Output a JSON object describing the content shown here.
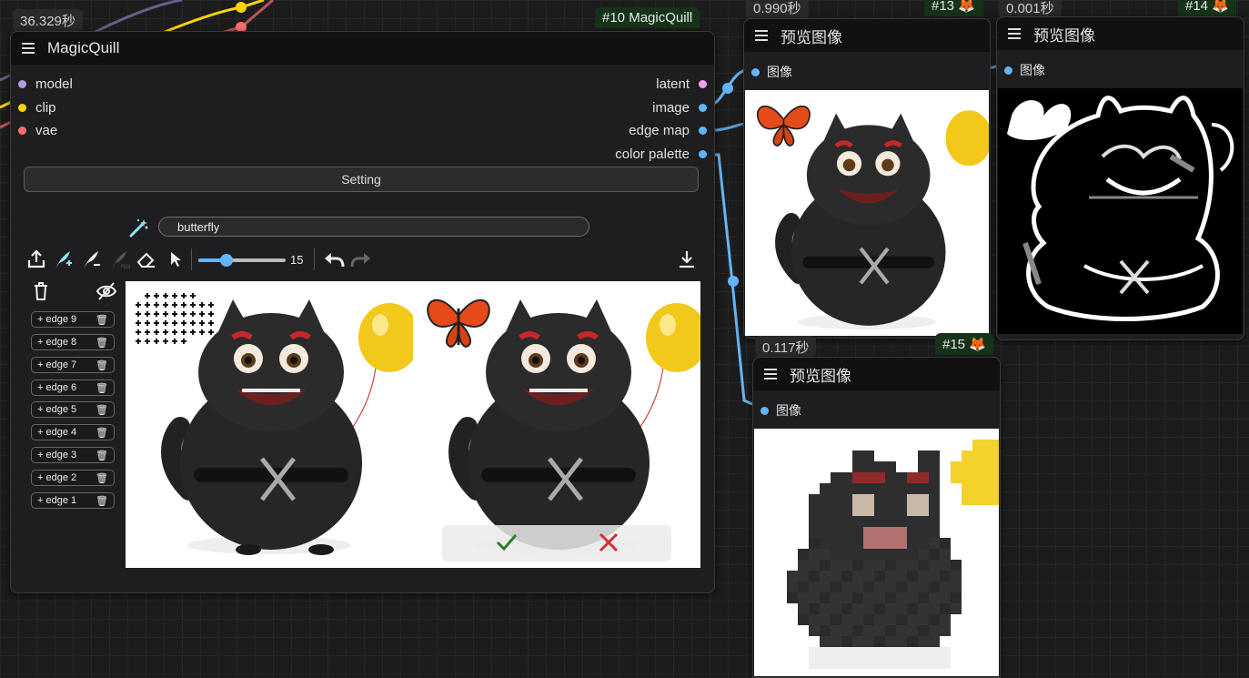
{
  "magicquill": {
    "time": "36.329秒",
    "id_badge": "#10 MagicQuill",
    "title": "MagicQuill",
    "inputs": [
      {
        "label": "model",
        "color": "#b39ddb"
      },
      {
        "label": "clip",
        "color": "#ffd500"
      },
      {
        "label": "vae",
        "color": "#ff6e6e"
      }
    ],
    "outputs": [
      {
        "label": "latent",
        "color": "#ff9cf9"
      },
      {
        "label": "image",
        "color": "#64b5f6"
      },
      {
        "label": "edge map",
        "color": "#64b5f6"
      },
      {
        "label": "color palette",
        "color": "#64b5f6"
      }
    ],
    "setting_label": "Setting",
    "prompt_value": "butterfly",
    "brush_size": "15",
    "edges": [
      "+ edge 9",
      "+ edge 8",
      "+ edge 7",
      "+ edge 6",
      "+ edge 5",
      "+ edge 4",
      "+ edge 3",
      "+ edge 2",
      "+ edge 1"
    ]
  },
  "preview13": {
    "time": "0.990秒",
    "id_badge": "#13",
    "title": "预览图像",
    "input_label": "图像"
  },
  "preview14": {
    "time": "0.001秒",
    "id_badge": "#14",
    "title": "预览图像",
    "input_label": "图像"
  },
  "preview15": {
    "time": "0.117秒",
    "id_badge": "#15",
    "title": "预览图像",
    "input_label": "图像"
  },
  "colors": {
    "background": "#1c1c1c",
    "node_bg": "#1e1e20",
    "wire_blue": "#64b5f6",
    "accept_green": "#2e7d32",
    "reject_red": "#d32f2f"
  }
}
